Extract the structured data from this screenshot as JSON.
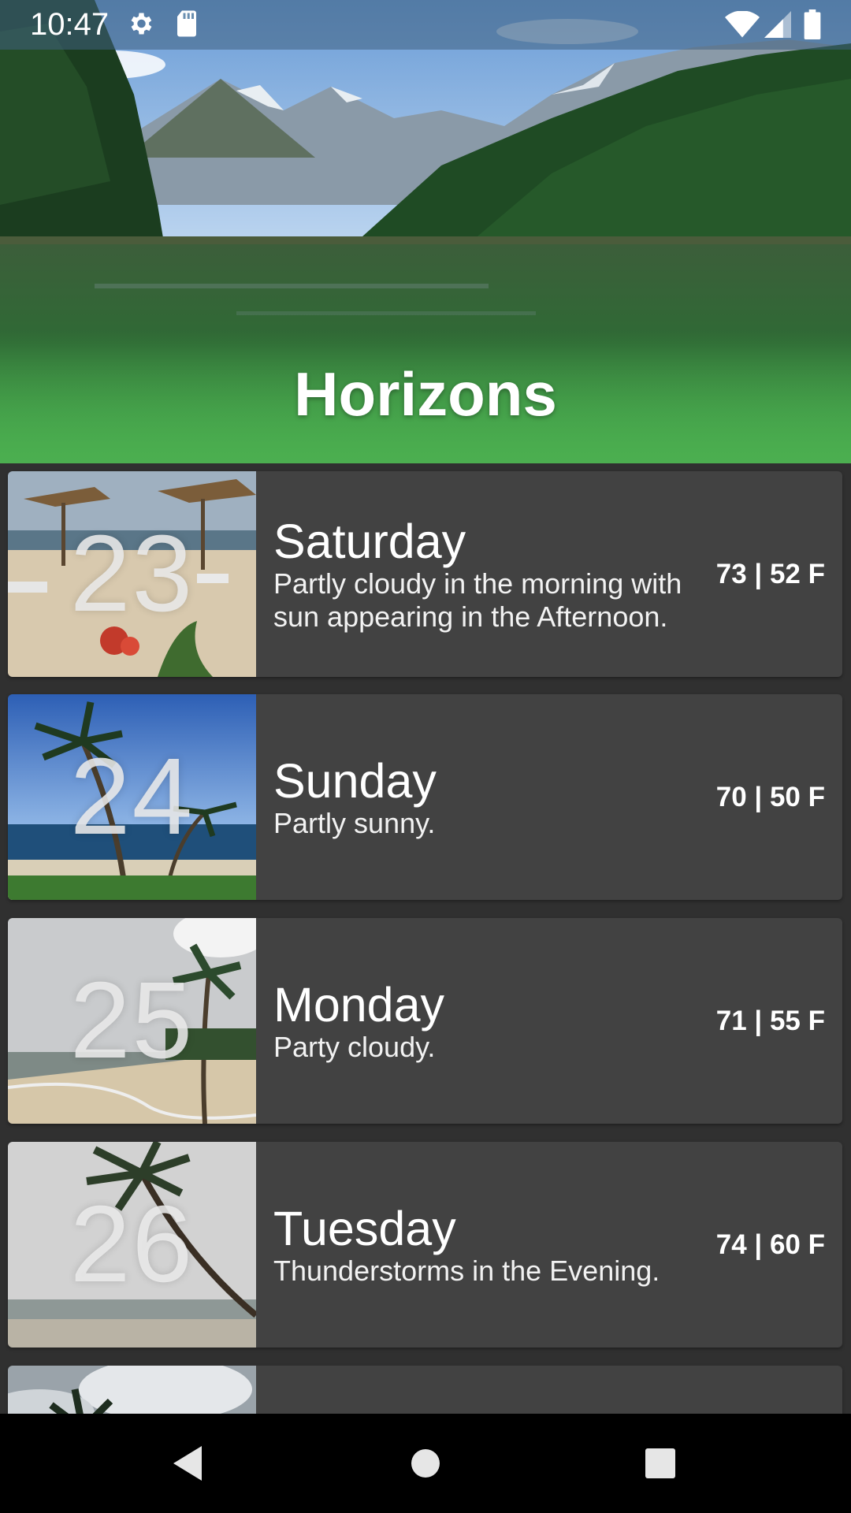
{
  "status_bar": {
    "time": "10:47",
    "left_icons": [
      "settings-icon",
      "sd-card-icon"
    ],
    "right_icons": [
      "wifi-icon",
      "cell-signal-icon",
      "battery-icon"
    ]
  },
  "header": {
    "title": "Horizons",
    "image": "mountain-lake-forest"
  },
  "forecast": [
    {
      "date": "23",
      "day": "Saturday",
      "description": "Partly cloudy in the morning with sun appearing in the Afternoon.",
      "temperature": "73 | 52 F",
      "image": "beach-umbrellas"
    },
    {
      "date": "24",
      "day": "Sunday",
      "description": "Partly sunny.",
      "temperature": "70 | 50 F",
      "image": "palm-trees-ocean"
    },
    {
      "date": "25",
      "day": "Monday",
      "description": "Party cloudy.",
      "temperature": "71 | 55 F",
      "image": "beach-cloudy"
    },
    {
      "date": "26",
      "day": "Tuesday",
      "description": "Thunderstorms in the Evening.",
      "temperature": "74 | 60 F",
      "image": "leaning-palm-stormy"
    },
    {
      "date": "",
      "day": "",
      "description": "",
      "temperature": "",
      "image": "palm-clouds"
    }
  ],
  "nav_bar": {
    "buttons": [
      "back-icon",
      "home-icon",
      "recents-icon"
    ]
  },
  "colors": {
    "background": "#303030",
    "card": "#424242",
    "header_gradient_end": "#4caf50",
    "nav_bar": "#000000"
  }
}
